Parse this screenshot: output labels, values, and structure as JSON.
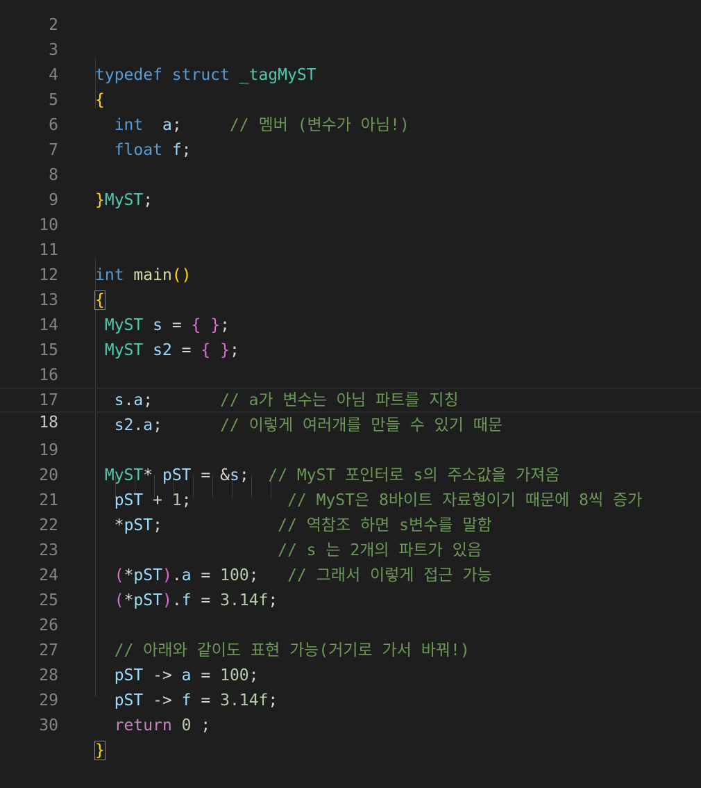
{
  "editor": {
    "lines": [
      {
        "n": "2"
      },
      {
        "n": "3",
        "kw1": "typedef",
        "kw2": "struct",
        "name": "_tagMyST"
      },
      {
        "n": "4",
        "brace": "{"
      },
      {
        "n": "5",
        "type": "int",
        "var": "a",
        "semi": ";",
        "comment": "// 멤버 (변수가 아님!)"
      },
      {
        "n": "6",
        "type": "float",
        "var": "f",
        "semi": ";"
      },
      {
        "n": "7"
      },
      {
        "n": "8",
        "brace": "}",
        "name": "MyST",
        "semi": ";"
      },
      {
        "n": "9"
      },
      {
        "n": "10"
      },
      {
        "n": "11",
        "type": "int",
        "fn": "main",
        "parens": "()"
      },
      {
        "n": "12",
        "brace": "{"
      },
      {
        "n": "13",
        "type": "MyST",
        "var": "s",
        "eq": "=",
        "open": "{",
        "close": "}",
        "semi": ";"
      },
      {
        "n": "14",
        "type": "MyST",
        "var": "s2",
        "eq": "=",
        "open": "{",
        "close": "}",
        "semi": ";"
      },
      {
        "n": "15"
      },
      {
        "n": "16",
        "obj": "s",
        "dot": ".",
        "member": "a",
        "semi": ";",
        "comment": "// a가 변수는 아님 파트를 지칭"
      },
      {
        "n": "17",
        "obj": "s2",
        "dot": ".",
        "member": "a",
        "semi": ";",
        "comment": "// 이렇게 여러개를 만들 수 있기 때문"
      },
      {
        "n": "18"
      },
      {
        "n": "19",
        "type": "MyST",
        "star": "*",
        "var": "pST",
        "eq": "=",
        "amp": "&",
        "rhs": "s",
        "semi": ";",
        "comment": "// MyST 포인터로 s의 주소값을 가져옴"
      },
      {
        "n": "20",
        "var": "pST",
        "op": "+",
        "num": "1",
        "semi": ";",
        "comment": "// MyST은 8바이트 자료형이기 때문에 8씩 증가"
      },
      {
        "n": "21",
        "star": "*",
        "var": "pST",
        "semi": ";",
        "comment": "// 역참조 하면 s변수를 말함"
      },
      {
        "n": "22",
        "comment": "// s 는 2개의 파트가 있음"
      },
      {
        "n": "23",
        "open": "(",
        "star": "*",
        "var": "pST",
        "close": ")",
        "dot": ".",
        "member": "a",
        "eq": "=",
        "num": "100",
        "semi": ";",
        "comment": "// 그래서 이렇게 접근 가능"
      },
      {
        "n": "24",
        "open": "(",
        "star": "*",
        "var": "pST",
        "close": ")",
        "dot": ".",
        "member": "f",
        "eq": "=",
        "num": "3.14f",
        "semi": ";"
      },
      {
        "n": "25"
      },
      {
        "n": "26",
        "comment": "// 아래와 같이도 표현 가능(거기로 가서 바꿔!)"
      },
      {
        "n": "27",
        "var": "pST",
        "arrow": "->",
        "member": "a",
        "eq": "=",
        "num": "100",
        "semi": ";"
      },
      {
        "n": "28",
        "var": "pST",
        "arrow": "->",
        "member": "f",
        "eq": "=",
        "num": "3.14f",
        "semi": ";"
      },
      {
        "n": "29",
        "kw": "return",
        "num": "0",
        "semi": ";"
      },
      {
        "n": "30",
        "brace": "}"
      }
    ]
  },
  "theme": {
    "background": "#1e1e1e",
    "keyword": "#569cd6",
    "control": "#c586c0",
    "type": "#4ec9b0",
    "variable": "#9cdcfe",
    "function": "#dcdcaa",
    "number": "#b5cea8",
    "comment": "#6a9955",
    "bracket_1": "#ffd700",
    "bracket_2": "#da70d6"
  }
}
